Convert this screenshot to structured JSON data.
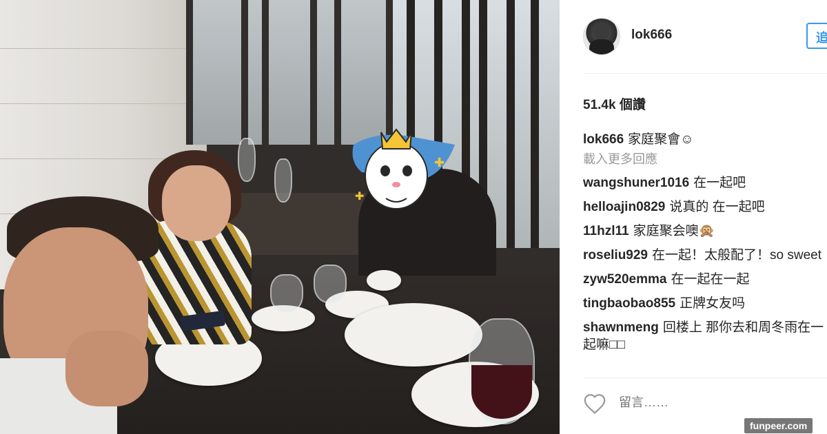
{
  "post": {
    "username": "lok666",
    "follow_label": "追",
    "views": "51.4k 個讚",
    "caption": {
      "user": "lok666",
      "text": "家庭聚會☺"
    },
    "load_more": "載入更多回應",
    "comments": [
      {
        "user": "wangshuner1016",
        "text": "在一起吧"
      },
      {
        "user": "helloajin0829",
        "text": "说真的 在一起吧"
      },
      {
        "user": "11hzl11",
        "text": "家庭聚会噢🙊"
      },
      {
        "user": "roseliu929",
        "text": "在一起！太般配了！so sweet"
      },
      {
        "user": "zyw520emma",
        "text": "在一起在一起"
      },
      {
        "user": "tingbaobao855",
        "text": "正牌女友吗"
      },
      {
        "user": "shawnmeng",
        "text": "回楼上 那你去和周冬雨在一起嘛□□"
      }
    ],
    "comment_placeholder": "留言……"
  },
  "watermark": "funpeer.com",
  "colors": {
    "follow_blue": "#3897f0",
    "text": "#262626",
    "muted": "#999999"
  },
  "icons": {
    "heart": "heart-icon",
    "sticker": "crowned-cartoon-sticker"
  }
}
